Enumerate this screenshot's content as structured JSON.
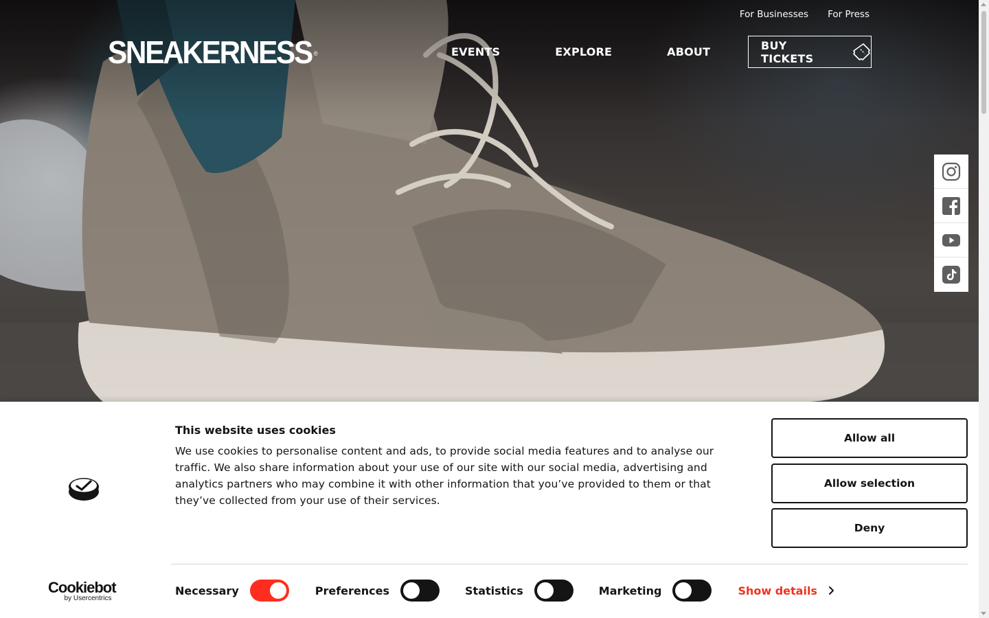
{
  "header": {
    "utility_links": [
      "For Businesses",
      "For Press"
    ],
    "logo": "SNEAKERNESS",
    "logo_mark": "®",
    "nav": {
      "events": "EVENTS",
      "explore": "EXPLORE",
      "about": "ABOUT"
    },
    "buy_tickets": "BUY TICKETS"
  },
  "social": [
    "instagram-icon",
    "facebook-icon",
    "youtube-icon",
    "tiktok-icon"
  ],
  "cookie_banner": {
    "title": "This website uses cookies",
    "body": "We use cookies to personalise content and ads, to provide social media features and to analyse our traffic. We also share information about your use of our site with our social media, advertising and analytics partners who may combine it with other information that you’ve provided to them or that they’ve collected from your use of their services.",
    "buttons": {
      "allow_all": "Allow all",
      "allow_selection": "Allow selection",
      "deny": "Deny"
    },
    "brand": {
      "name": "Cookiebot",
      "sub": "by Usercentrics"
    },
    "categories": [
      {
        "label": "Necessary",
        "checked": true
      },
      {
        "label": "Preferences",
        "checked": false
      },
      {
        "label": "Statistics",
        "checked": false
      },
      {
        "label": "Marketing",
        "checked": false
      }
    ],
    "show_details": "Show details"
  },
  "colors": {
    "toggle_on": "#ff2d1f",
    "toggle_off": "#141414",
    "link_accent": "#f0321e"
  }
}
